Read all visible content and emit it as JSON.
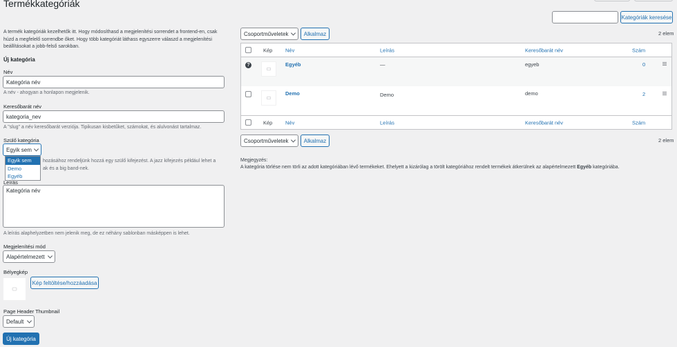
{
  "page": {
    "title": "Termékkategóriák",
    "search_button": "Kategóriák keresése",
    "search_placeholder": ""
  },
  "form": {
    "intro": "A termék kategóriák kezelhetők itt. Hogy módosíthasd a megjelenítési sorrendet a frontend-en, csak húzd a megfelelő sorrendbe őket. Hogy több kategóriát láthass egyszerre válaszd a megjelenítési beállításokat a jobb-felső sarokban.",
    "heading": "Új kategória",
    "name_label": "Név",
    "name_value": "Kategória név",
    "name_help": "A név - ahogyan a honlapon megjelenik.",
    "slug_label": "Keresőbarát név",
    "slug_value": "kategoria_nev",
    "slug_help": "A \"slug\" a név keresőbarát verziója. Tipikusan kisbetűket, számokat, és alulvonást tartalmaz.",
    "parent_label": "Szülő kategória",
    "parent_selected": "Egyik sem",
    "parent_options": [
      "Egyik sem",
      "Demo",
      "Egyéb"
    ],
    "parent_help_part1": "hozásához rendeljünk hozzá egy szülő kifejezést. A jazz kifejezés például lehet a",
    "parent_help_part2": "ak és a big band-nek.",
    "description_label": "Leírás",
    "description_value": "Kategória név",
    "description_help": "A leírás alaphelyzetben nem jelenik meg, de ez néhány sablonban másképpen is lehet.",
    "display_label": "Megjelenítési mód",
    "display_selected": "Alapértelmezett",
    "thumbnail_label": "Bélyegkép",
    "upload_button": "Kép feltöltése/hozzáadása",
    "header_thumb_label": "Page Header Thumbnail",
    "header_thumb_selected": "Default",
    "submit_button": "Új kategória"
  },
  "list": {
    "bulk_actions": "Csoportműveletek",
    "apply": "Alkalmaz",
    "count": "2 elem",
    "columns": {
      "image": "Kép",
      "name": "Név",
      "description": "Leírás",
      "slug": "Keresőbarát név",
      "count": "Szám"
    },
    "rows": [
      {
        "name": "Egyéb",
        "description": "—",
        "slug": "egyeb",
        "count": "0",
        "help_icon": "?"
      },
      {
        "name": "Demo",
        "description": "Demo",
        "slug": "demo",
        "count": "2"
      }
    ],
    "note_title": "Megjegyzés:",
    "note_text_before": "A kategória törlése nem törli az adott kategóriában lévő termékeket. Ehelyett a kizárólag a törölt kategóriához rendelt termékek átkerülnek az alapértelmezett ",
    "note_text_bold": "Egyéb",
    "note_text_after": " kategóriába."
  }
}
